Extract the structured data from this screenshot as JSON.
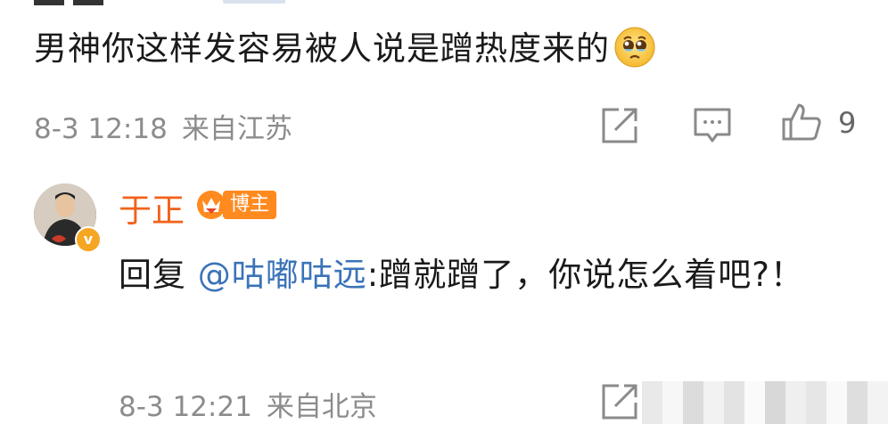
{
  "comment": {
    "text": "男神你这样发容易被人说是蹭热度来的",
    "emoji": "crying-face-emoji",
    "date": "8-3 12:18",
    "location": "来自江苏",
    "like_count": "9"
  },
  "reply": {
    "username": "于正",
    "badge_label": "博主",
    "reply_prefix": "回复",
    "mention": "@咕嘟咕远",
    "body": ":蹭就蹭了，你说怎么着吧?！",
    "date": "8-3 12:21",
    "location": "来自北京"
  },
  "icons": {
    "share": "share-icon",
    "comment": "comment-icon",
    "like": "like-icon",
    "verified": "verified-v-icon",
    "crown": "crown-badge-icon"
  },
  "colors": {
    "username": "#f0631b",
    "mention": "#3a73b8",
    "meta": "#8c8c8c",
    "badge": "#ff8a1f"
  }
}
